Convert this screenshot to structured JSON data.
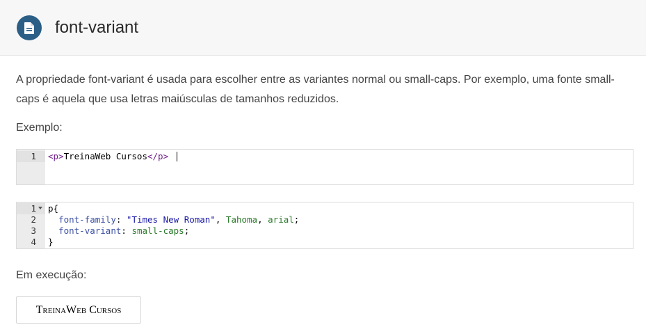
{
  "header": {
    "title": "font-variant",
    "icon": "document-icon",
    "icon_color": "#2b5f86"
  },
  "description": "A propriedade font-variant é usada para escolher entre as variantes normal ou small-caps. Por exemplo, uma fonte small-caps é aquela que usa letras maiúsculas de tamanhos reduzidos.",
  "example_label": "Exemplo:",
  "html_editor": {
    "line_numbers": [
      "1"
    ],
    "tag_open": "<p>",
    "text": "TreinaWeb Cursos",
    "tag_close": "</p>"
  },
  "css_editor": {
    "line_numbers": [
      "1",
      "2",
      "3",
      "4"
    ],
    "lines": {
      "l1": "p{",
      "l2_prop": "font-family",
      "l2_colon": ": ",
      "l2_str": "\"Times New Roman\"",
      "l2_sep1": ", ",
      "l2_v1": "Tahoma",
      "l2_sep2": ", ",
      "l2_v2": "arial",
      "l2_end": ";",
      "l3_prop": "font-variant",
      "l3_colon": ": ",
      "l3_val": "small-caps",
      "l3_end": ";",
      "l4": "}"
    }
  },
  "running_label": "Em execução:",
  "result_text": "TreinaWeb Cursos"
}
